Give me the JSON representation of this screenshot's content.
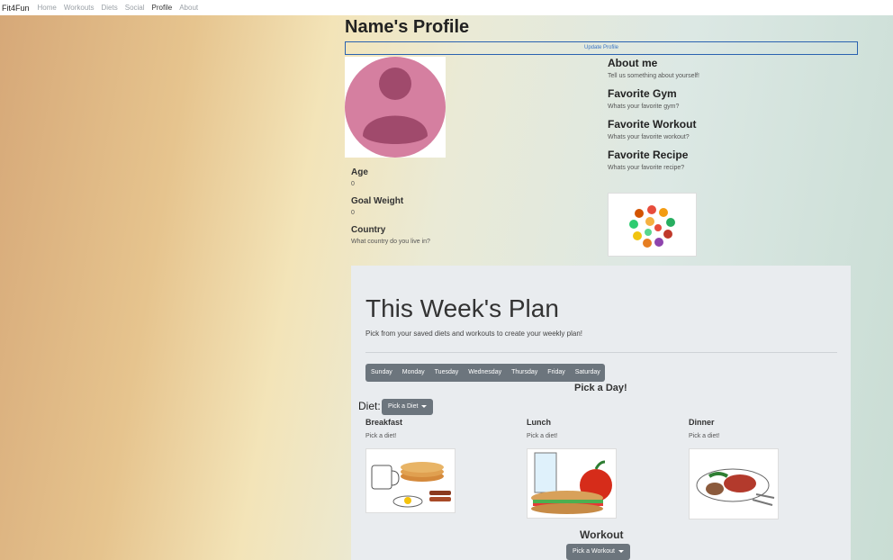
{
  "nav": {
    "brand": "Fit4Fun",
    "links": [
      "Home",
      "Workouts",
      "Diets",
      "Social",
      "Profile",
      "About"
    ]
  },
  "profile": {
    "title": "Name's Profile",
    "update_button": "Update Profile",
    "left": [
      {
        "label": "Age",
        "value": "0"
      },
      {
        "label": "Goal Weight",
        "value": "0"
      },
      {
        "label": "Country",
        "value": "What country do you live in?"
      }
    ],
    "right": [
      {
        "label": "About me",
        "value": "Tell us something about yourself!"
      },
      {
        "label": "Favorite Gym",
        "value": "Whats your favorite gym?"
      },
      {
        "label": "Favorite Workout",
        "value": "Whats your favorite workout?"
      },
      {
        "label": "Favorite Recipe",
        "value": "Whats your favorite recipe?"
      }
    ]
  },
  "plan": {
    "title": "This Week's Plan",
    "subtitle": "Pick from your saved diets and workouts to create your weekly plan!",
    "days": [
      "Sunday",
      "Monday",
      "Tuesday",
      "Wednesday",
      "Thursday",
      "Friday",
      "Saturday"
    ],
    "pick_day": "Pick a Day!",
    "diet_label": "Diet:",
    "diet_dropdown": "Pick a Diet",
    "meals": [
      {
        "label": "Breakfast",
        "hint": "Pick a diet!"
      },
      {
        "label": "Lunch",
        "hint": "Pick a diet!"
      },
      {
        "label": "Dinner",
        "hint": "Pick a diet!"
      }
    ],
    "workout_label": "Workout",
    "workout_dropdown": "Pick a Workout"
  },
  "colors": {
    "avatar_bg": "#d57fa0",
    "avatar_fg": "#a04a6c",
    "button_gray": "#6c757d",
    "update_border": "#2a62b0"
  }
}
